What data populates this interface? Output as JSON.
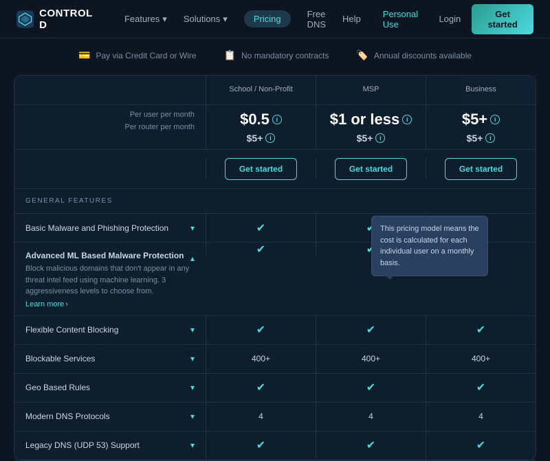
{
  "brand": {
    "name": "CONTROL D",
    "logo_alt": "Control D Logo"
  },
  "navbar": {
    "links": [
      {
        "label": "Features",
        "has_arrow": true
      },
      {
        "label": "Solutions",
        "has_arrow": true
      },
      {
        "label": "Pricing",
        "active": true
      },
      {
        "label": "Free DNS"
      },
      {
        "label": "Help"
      }
    ],
    "personal_use": "Personal Use",
    "login": "Login",
    "get_started": "Get started"
  },
  "badges": [
    {
      "icon": "💳",
      "text": "Pay via Credit Card or Wire"
    },
    {
      "icon": "📋",
      "text": "No mandatory contracts"
    },
    {
      "icon": "🏷️",
      "text": "Annual discounts available"
    }
  ],
  "pricing_table": {
    "columns": [
      {
        "id": "empty"
      },
      {
        "id": "school",
        "title": "School / Non-Profit"
      },
      {
        "id": "msp",
        "title": "MSP"
      },
      {
        "id": "business",
        "title": "Business"
      }
    ],
    "per_user_label": "Per user per month",
    "per_router_label": "Per router per month",
    "prices": [
      {
        "col": "school",
        "user": "$0.5",
        "router": "$5+"
      },
      {
        "col": "msp",
        "user": "$1 or less",
        "router": "$5+"
      },
      {
        "col": "business",
        "user": "$5+",
        "router": "$5+"
      }
    ],
    "get_started_label": "Get started",
    "section_label": "GENERAL FEATURES",
    "tooltip": "This pricing model means the cost is calculated for each individual user on a monthly basis.",
    "features": [
      {
        "label": "Basic Malware and Phishing Protection",
        "expanded": false,
        "school": "check",
        "msp": "check",
        "business": "check"
      },
      {
        "label": "Advanced ML Based Malware Protection",
        "expanded": true,
        "desc": "Block malicious domains that don't appear in any threat intel feed using machine learning. 3 aggressiveness levels to choose from.",
        "learn_more": "Learn more",
        "school": "check",
        "msp": "check",
        "business": "check"
      },
      {
        "label": "Flexible Content Blocking",
        "expanded": false,
        "school": "check",
        "msp": "check",
        "business": "check"
      },
      {
        "label": "Blockable Services",
        "expanded": false,
        "school": "400+",
        "msp": "400+",
        "business": "400+"
      },
      {
        "label": "Geo Based Rules",
        "expanded": false,
        "school": "check",
        "msp": "check",
        "business": "check"
      },
      {
        "label": "Modern DNS Protocols",
        "expanded": false,
        "school": "4",
        "msp": "4",
        "business": "4"
      },
      {
        "label": "Legacy DNS (UDP 53) Support",
        "expanded": false,
        "school": "check",
        "msp": "check",
        "business": "check"
      }
    ]
  }
}
